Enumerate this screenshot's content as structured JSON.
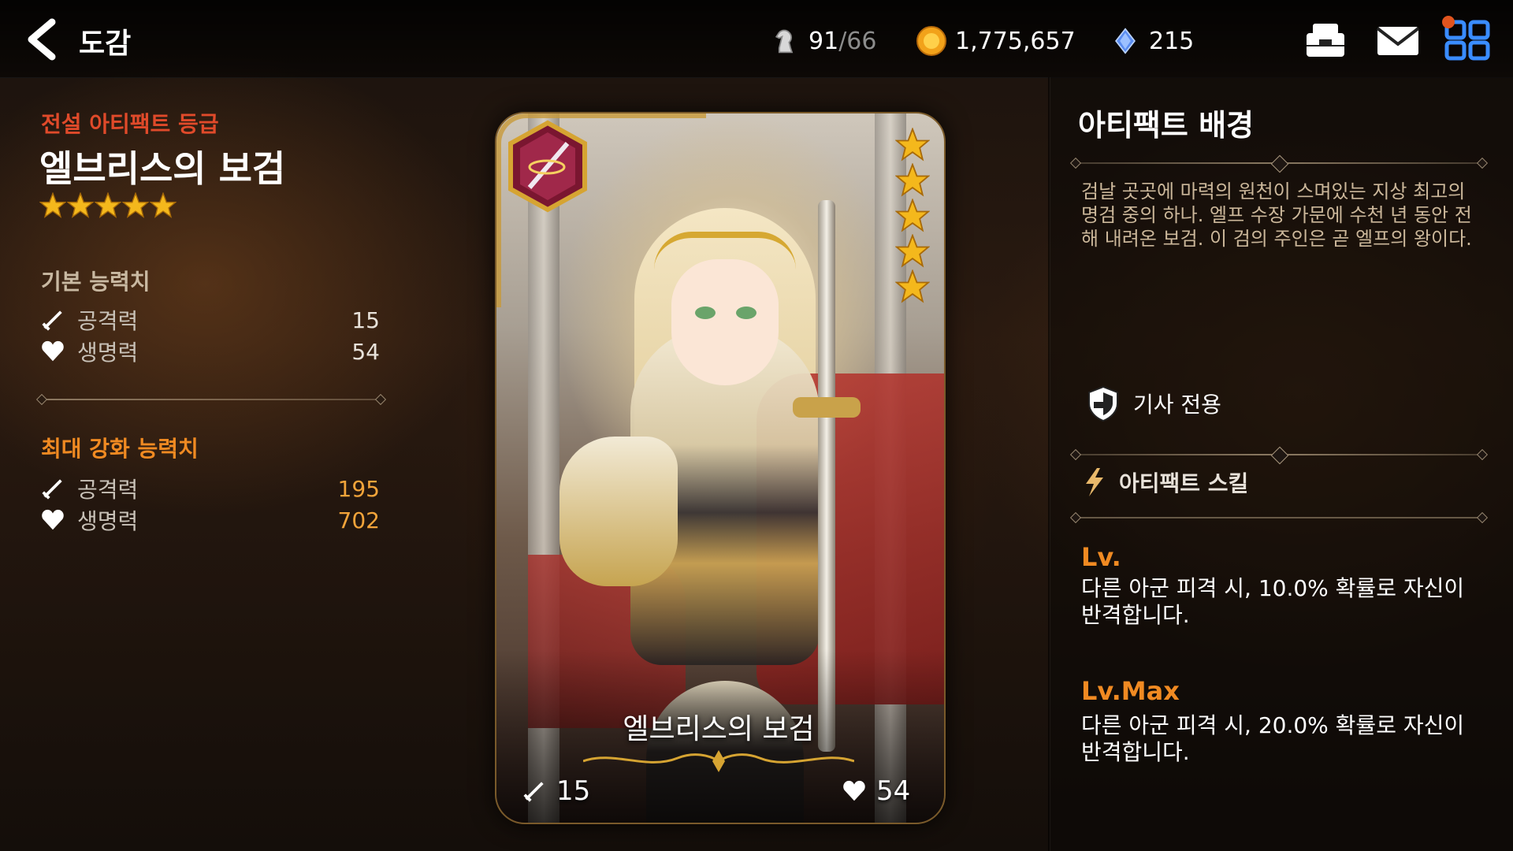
{
  "header": {
    "title": "도감",
    "stamina": {
      "value": "91",
      "max": "/66"
    },
    "gold": "1,775,657",
    "crystal": "215"
  },
  "artifact": {
    "grade": "전설 아티팩트 등급",
    "name": "엘브리스의 보검",
    "stars": 5
  },
  "base_stats": {
    "title": "기본 능력치",
    "attack_label": "공격력",
    "attack": "15",
    "hp_label": "생명력",
    "hp": "54"
  },
  "max_stats": {
    "title": "최대 강화 능력치",
    "attack_label": "공격력",
    "attack": "195",
    "hp_label": "생명력",
    "hp": "702"
  },
  "card": {
    "name": "엘브리스의 보검",
    "attack": "15",
    "hp": "54"
  },
  "background": {
    "title": "아티팩트 배경",
    "description": "검날 곳곳에 마력의 원천이 스며있는 지상 최고의 명검 중의 하나. 엘프 수장 가문에 수천 년 동안 전해 내려온 보검. 이 검의 주인은 곧 엘프의 왕이다.",
    "class_restriction": "기사 전용"
  },
  "skill": {
    "title": "아티팩트 스킬",
    "lv_label": "Lv.",
    "lv_desc": "다른 아군 피격 시, 10.0% 확률로 자신이 반격합니다.",
    "lvmax_label": "Lv.Max",
    "lvmax_desc": "다른 아군 피격 시, 20.0% 확률로 자신이 반격합니다."
  },
  "colors": {
    "grade": "#e04a2a",
    "max_value": "#f3a43a",
    "skill_level": "#f08a22",
    "star": "#f4b81c"
  },
  "icons": [
    "back-arrow-icon",
    "chess-knight-icon",
    "gold-coin-icon",
    "crystal-icon",
    "inventory-chest-icon",
    "mail-icon",
    "menu-grid-icon",
    "sword-icon",
    "heart-icon",
    "knight-shield-icon",
    "lightning-icon",
    "star-icon"
  ]
}
